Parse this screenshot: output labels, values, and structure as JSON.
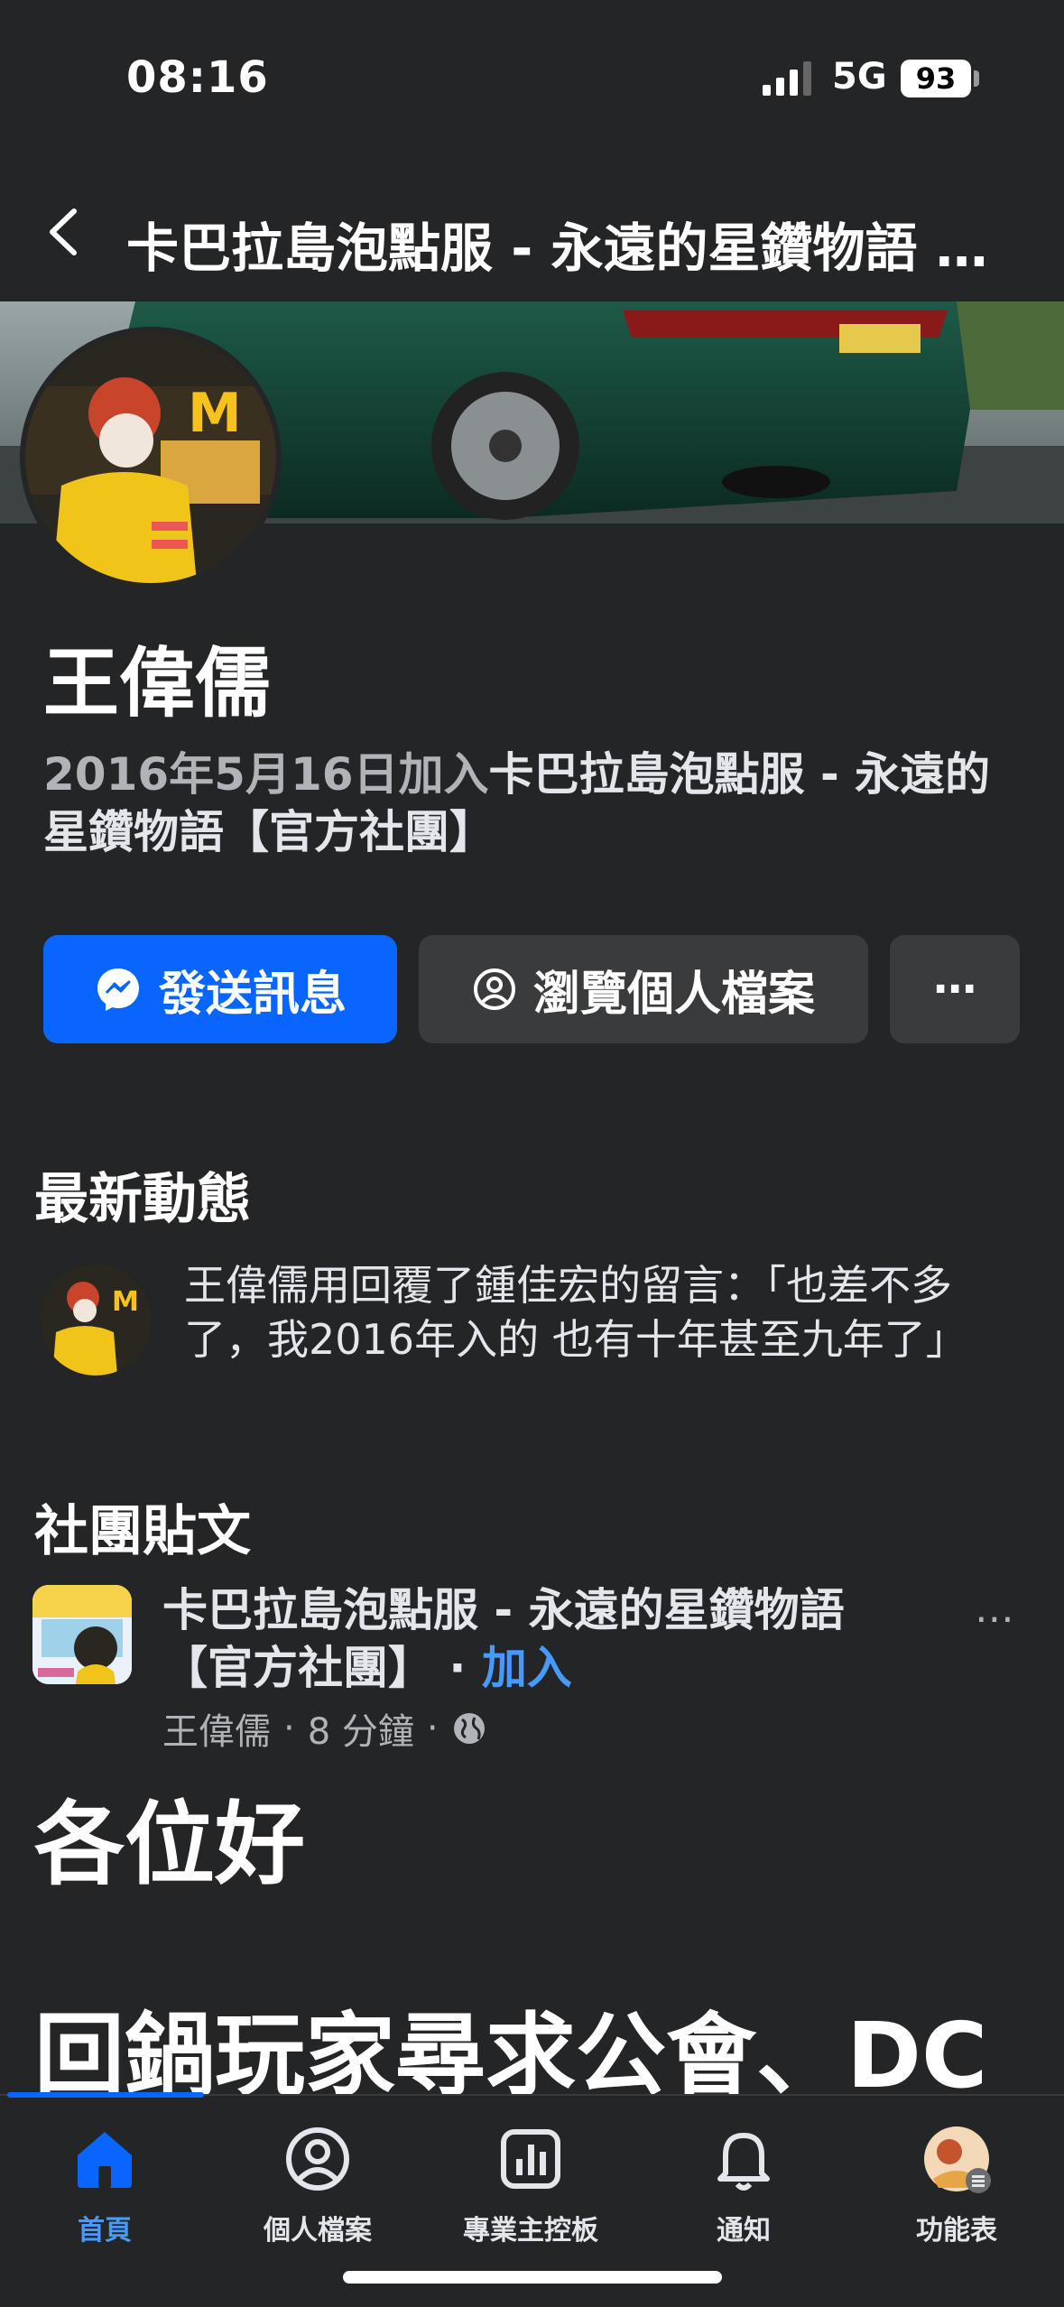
{
  "status_bar": {
    "time": "08:16",
    "network": "5G",
    "battery": "93"
  },
  "header": {
    "title": "卡巴拉島泡點服 - 永遠的星鑽物語 …"
  },
  "profile": {
    "name": "王偉儒",
    "joined_date": "2016年5月16日加入",
    "joined_group": "卡巴拉島泡點服 - 永遠的星鑽物語【官方社團】"
  },
  "actions": {
    "message_label": "發送訊息",
    "profile_label": "瀏覽個人檔案",
    "more_label": "⋯"
  },
  "recent_activity": {
    "title": "最新動態",
    "text": "王偉儒用回覆了鍾佳宏的留言：「也差不多了，我2016年入的 也有十年甚至九年了」"
  },
  "group_posts": {
    "title": "社團貼文",
    "group_name": "卡巴拉島泡點服 - 永遠的星鑽物語【官方社團】",
    "separator": " · ",
    "join_label": "加入",
    "author": "王偉儒",
    "time": "8 分鐘",
    "more_label": "⋯",
    "body_line1": "各位好",
    "body_line2": "回鍋玩家尋求公會、DC"
  },
  "bottom_nav": [
    {
      "label": "首頁",
      "icon": "home-icon",
      "active": true
    },
    {
      "label": "個人檔案",
      "icon": "profile-icon",
      "active": false
    },
    {
      "label": "專業主控板",
      "icon": "dashboard-icon",
      "active": false
    },
    {
      "label": "通知",
      "icon": "bell-icon",
      "active": false
    },
    {
      "label": "功能表",
      "icon": "menu-avatar-icon",
      "active": false
    }
  ],
  "colors": {
    "accent": "#0866ff",
    "link": "#4599ff",
    "background": "#242526",
    "button_secondary": "#3a3b3c"
  }
}
